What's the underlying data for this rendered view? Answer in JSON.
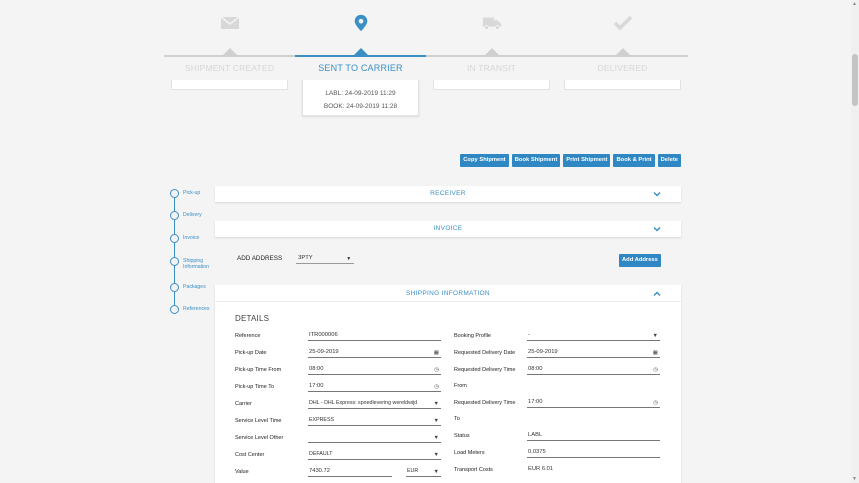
{
  "steps": [
    {
      "label": "SHIPMENT CREATED",
      "icon": "envelope-icon",
      "active": false
    },
    {
      "label": "SENT TO CARRIER",
      "icon": "map-pin-icon",
      "active": true,
      "details": [
        "LABL: 24-09-2019 11:29",
        "BOOK: 24-09-2019 11:28"
      ]
    },
    {
      "label": "IN TRANSIT",
      "icon": "truck-icon",
      "active": false
    },
    {
      "label": "DELIVERED",
      "icon": "checkmark-icon",
      "active": false
    }
  ],
  "toolbar": {
    "copy": "Copy Shipment",
    "book": "Book Shipment",
    "print": "Print Shipment",
    "book_print": "Book & Print",
    "delete": "Delete"
  },
  "sidenav": [
    "Pick-up",
    "Delivery",
    "Invoice",
    "Shipping Information",
    "Packages",
    "References"
  ],
  "panels": {
    "receiver": "RECEIVER",
    "invoice": "INVOICE",
    "shipping": "SHIPPING INFORMATION"
  },
  "add_address": {
    "label": "ADD ADDRESS",
    "value": "3PTY",
    "button": "Add Address"
  },
  "details": {
    "title": "DETAILS",
    "left": [
      {
        "label": "Reference",
        "value": "ITR000006"
      },
      {
        "label": "Pick-up Date",
        "value": "25-09-2019"
      },
      {
        "label": "Pick-up Time From",
        "value": "08:00"
      },
      {
        "label": "Pick-up Time To",
        "value": "17:00"
      },
      {
        "label": "Carrier",
        "value": "DHL - DHL Express: spoedlevering wereldwijd"
      },
      {
        "label": "Service Level Time",
        "value": "EXPRESS"
      },
      {
        "label": "Service Level Other",
        "value": ""
      },
      {
        "label": "Cost Center",
        "value": "DEFAULT"
      },
      {
        "label": "Value",
        "value": "7430.72",
        "currency": "EUR"
      }
    ],
    "right": [
      {
        "label": "Booking Profile",
        "value": "-"
      },
      {
        "label": "Requested Delivery Date",
        "value": "25-09-2019"
      },
      {
        "label": "Requested Delivery Time",
        "label2": "From",
        "value": "08:00"
      },
      {
        "label": "Requested Delivery Time",
        "label2": "To",
        "value": "17:00"
      },
      {
        "label": "Status",
        "value": "LABL"
      },
      {
        "label": "Load Meters",
        "value": "0.0375"
      },
      {
        "label": "Transport Costs",
        "value": "EUR 6.01"
      }
    ]
  },
  "colors": {
    "accent": "#3a8fc7",
    "button": "#2f87c3",
    "inactive": "#d0d0d0"
  }
}
